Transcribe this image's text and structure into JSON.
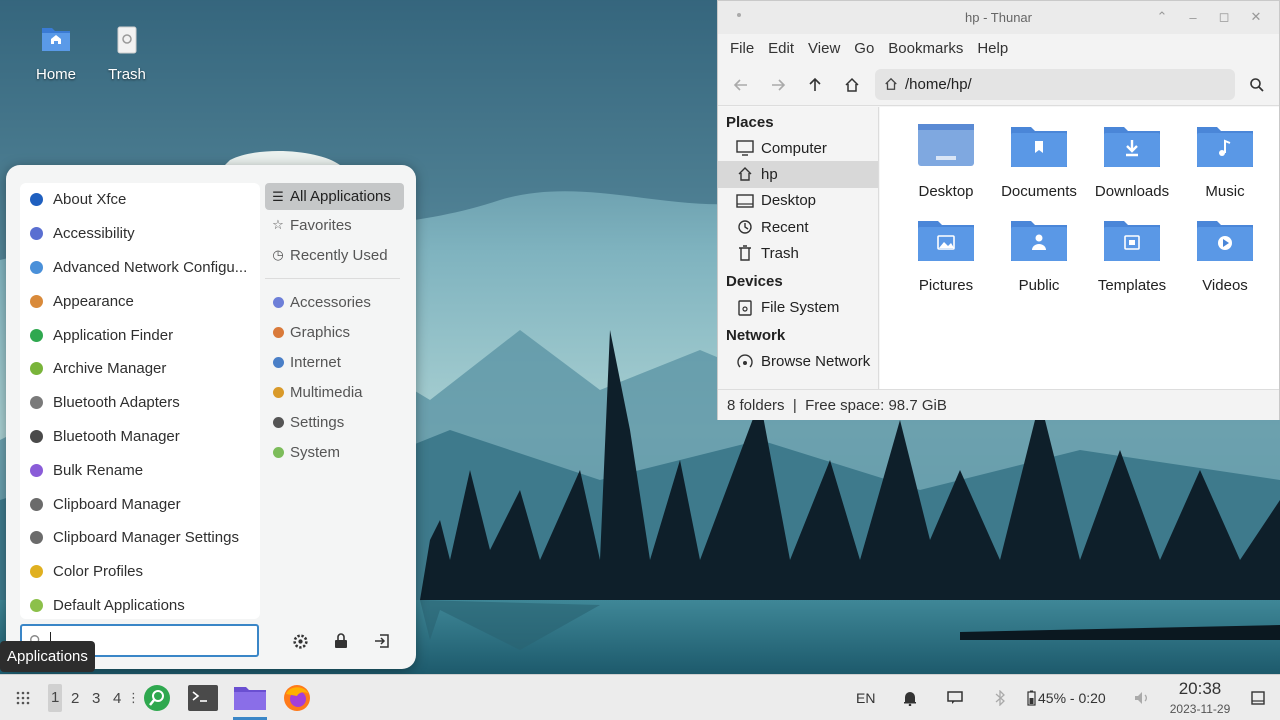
{
  "desktop": {
    "icons": [
      {
        "label": "Home"
      },
      {
        "label": "Trash"
      }
    ]
  },
  "app_menu": {
    "apps": [
      {
        "label": "About Xfce",
        "color": "#1f5fbf"
      },
      {
        "label": "Accessibility",
        "color": "#5a6fd1"
      },
      {
        "label": "Advanced Network Configu...",
        "color": "#4a90d9"
      },
      {
        "label": "Appearance",
        "color": "#d98a3a"
      },
      {
        "label": "Application Finder",
        "color": "#2fa84f"
      },
      {
        "label": "Archive Manager",
        "color": "#79b43a"
      },
      {
        "label": "Bluetooth Adapters",
        "color": "#7a7a7a"
      },
      {
        "label": "Bluetooth Manager",
        "color": "#4a4a4a"
      },
      {
        "label": "Bulk Rename",
        "color": "#8a5cd8"
      },
      {
        "label": "Clipboard Manager",
        "color": "#6b6b6b"
      },
      {
        "label": "Clipboard Manager Settings",
        "color": "#6b6b6b"
      },
      {
        "label": "Color Profiles",
        "color": "#e0b020"
      },
      {
        "label": "Default Applications",
        "color": "#8cc04a"
      }
    ],
    "categories_top": [
      {
        "label": "All Applications",
        "icon": "list-icon"
      },
      {
        "label": "Favorites",
        "icon": "star-icon"
      },
      {
        "label": "Recently Used",
        "icon": "clock-icon"
      }
    ],
    "categories": [
      {
        "label": "Accessories",
        "color": "#6d7fd8"
      },
      {
        "label": "Graphics",
        "color": "#d97a3a"
      },
      {
        "label": "Internet",
        "color": "#4a7fc7"
      },
      {
        "label": "Multimedia",
        "color": "#d99a2a"
      },
      {
        "label": "Settings",
        "color": "#555555"
      },
      {
        "label": "System",
        "color": "#7cbc5a"
      }
    ],
    "search_value": "",
    "tooltip": "Applications"
  },
  "thunar": {
    "title": "hp - Thunar",
    "menus": [
      "File",
      "Edit",
      "View",
      "Go",
      "Bookmarks",
      "Help"
    ],
    "path": "/home/hp/",
    "sidebar": {
      "places_header": "Places",
      "places": [
        {
          "label": "Computer",
          "icon": "computer-icon"
        },
        {
          "label": "hp",
          "icon": "home-icon",
          "selected": true
        },
        {
          "label": "Desktop",
          "icon": "desktop-icon"
        },
        {
          "label": "Recent",
          "icon": "recent-icon"
        },
        {
          "label": "Trash",
          "icon": "trash-icon"
        }
      ],
      "devices_header": "Devices",
      "devices": [
        {
          "label": "File System",
          "icon": "drive-icon"
        }
      ],
      "network_header": "Network",
      "network": [
        {
          "label": "Browse Network",
          "icon": "network-icon"
        }
      ]
    },
    "folders": [
      {
        "label": "Desktop",
        "emblem": "desktop"
      },
      {
        "label": "Documents",
        "emblem": "document"
      },
      {
        "label": "Downloads",
        "emblem": "download"
      },
      {
        "label": "Music",
        "emblem": "music"
      },
      {
        "label": "Pictures",
        "emblem": "picture"
      },
      {
        "label": "Public",
        "emblem": "person"
      },
      {
        "label": "Templates",
        "emblem": "template"
      },
      {
        "label": "Videos",
        "emblem": "play"
      }
    ],
    "status": "8 folders  |  Free space: 98.7 GiB",
    "folder_color": "#4a86d8"
  },
  "taskbar": {
    "workspaces": [
      "1",
      "2",
      "3",
      "4"
    ],
    "keyboard_layout": "EN",
    "battery": "45% - 0:20",
    "clock_time": "20:38",
    "clock_date": "2023-11-29"
  }
}
